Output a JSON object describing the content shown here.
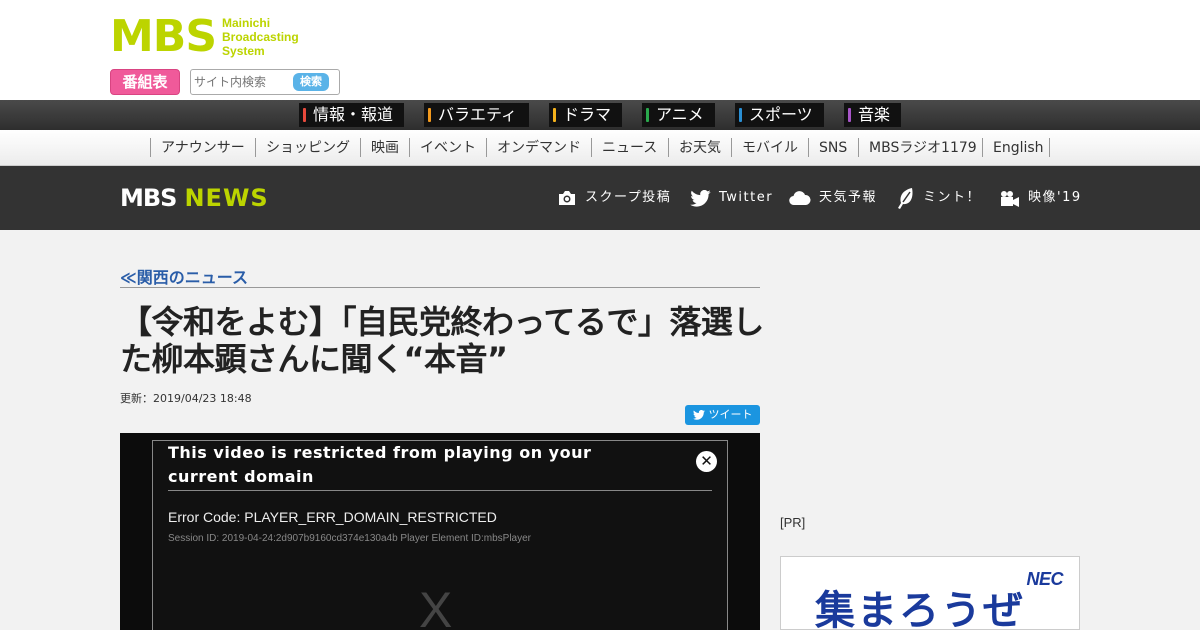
{
  "brand": {
    "logo_text": "MBS",
    "logo_sub_lines": [
      "Mainichi",
      "Broadcasting",
      "System"
    ]
  },
  "header": {
    "schedule_button": "番組表",
    "search_placeholder": "サイト内検索",
    "search_button": "検索"
  },
  "genres": [
    {
      "label": "情報・報道",
      "color": "#e84a3c"
    },
    {
      "label": "バラエティ",
      "color": "#f39a1e"
    },
    {
      "label": "ドラマ",
      "color": "#f5b21c"
    },
    {
      "label": "アニメ",
      "color": "#2aa94d"
    },
    {
      "label": "スポーツ",
      "color": "#2a8fd4"
    },
    {
      "label": "音楽",
      "color": "#a855c8"
    }
  ],
  "linknav": [
    "アナウンサー",
    "ショッピング",
    "映画",
    "イベント",
    "オンデマンド",
    "ニュース",
    "お天気",
    "モバイル",
    "SNS",
    "MBSラジオ1179",
    "English"
  ],
  "news_header": {
    "logo_mbs": "MBS",
    "logo_news": "NEWS",
    "links": [
      {
        "label": "スクープ投稿",
        "icon": "camera-icon"
      },
      {
        "label": "Twitter",
        "icon": "twitter-icon"
      },
      {
        "label": "天気予報",
        "icon": "cloud-icon"
      },
      {
        "label": "ミント！",
        "icon": "leaf-icon"
      },
      {
        "label": "映像'19",
        "icon": "video-camera-icon"
      }
    ]
  },
  "article": {
    "breadcrumb": "≪関西のニュース",
    "title": "【令和をよむ】「自民党終わってるで」落選した柳本顕さんに聞く“本音”",
    "updated": "更新：2019/04/23 18:48",
    "tweet_label": "ツイート"
  },
  "video_error": {
    "title": "This video is restricted from playing on your current domain",
    "code": "Error Code: PLAYER_ERR_DOMAIN_RESTRICTED",
    "session": "Session ID: 2019-04-24:2d907b9160cd374e130a4b Player Element ID:mbsPlayer",
    "close_glyph": "✕",
    "x_glyph": "X"
  },
  "sidebar": {
    "pr_label": "[PR]",
    "ad_brand": "NEC",
    "ad_copy": "集まろうぜ"
  },
  "colors": {
    "brand_green": "#bcd400",
    "schedule_pink": "#f05a9a",
    "search_blue": "#5ab3e8",
    "twitter_blue": "#1b95e0",
    "breadcrumb_blue": "#2a5da8"
  }
}
